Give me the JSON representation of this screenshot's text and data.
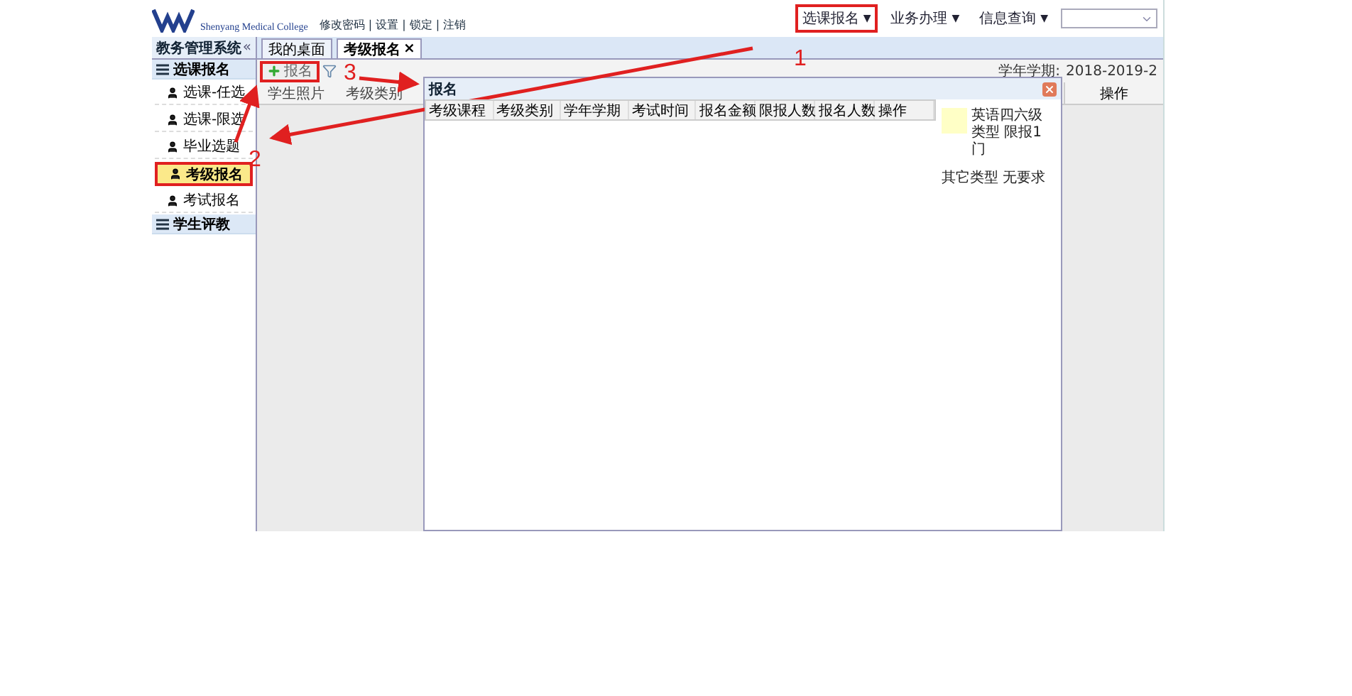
{
  "header": {
    "college": "Shenyang Medical College",
    "links_text": "修改密码 | 设置 | 锁定 | 注销",
    "menus": [
      {
        "label": "选课报名",
        "caret": "▼",
        "highlighted": true
      },
      {
        "label": "业务办理",
        "caret": "▼",
        "highlighted": false
      },
      {
        "label": "信息查询",
        "caret": "▼",
        "highlighted": false
      }
    ]
  },
  "sidebar": {
    "title": "教务管理系统",
    "collapse": "«",
    "groups": [
      {
        "label": "选课报名",
        "items": [
          {
            "label": "选课-任选",
            "selected": false
          },
          {
            "label": "选课-限选",
            "selected": false
          },
          {
            "label": "毕业选题",
            "selected": false
          },
          {
            "label": "考级报名",
            "selected": true
          },
          {
            "label": "考试报名",
            "selected": false
          }
        ]
      },
      {
        "label": "学生评教"
      }
    ]
  },
  "tabs": [
    {
      "label": "我的桌面",
      "selected": false
    },
    {
      "label": "考级报名",
      "selected": true,
      "close": "×"
    }
  ],
  "toolbar": {
    "button": {
      "label": "报名",
      "highlighted": true
    }
  },
  "grid": {
    "columns": [
      "学生照片",
      "考级类别"
    ],
    "term_label": "学年学期:",
    "term_value": "2018-2019-2",
    "action_column": "操作"
  },
  "dialog": {
    "title": "报名",
    "columns": [
      "考级课程",
      "考级类别",
      "学年学期",
      "考试时间",
      "报名金额",
      "限报人数",
      "报名人数",
      "操作"
    ],
    "legend": [
      {
        "text": "英语四六级类型 限报1门",
        "color": "#ffffc6"
      },
      {
        "text": "其它类型 无要求"
      }
    ]
  },
  "annotations": [
    {
      "label": "1"
    },
    {
      "label": "2"
    },
    {
      "label": "3"
    }
  ]
}
